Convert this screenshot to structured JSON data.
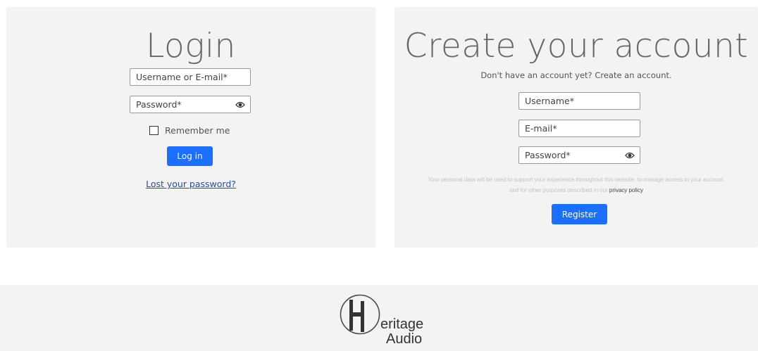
{
  "login": {
    "title": "Login",
    "username_placeholder": "Username or E-mail*",
    "password_placeholder": "Password*",
    "remember_label": "Remember me",
    "button_label": "Log in",
    "lost_password": "Lost your password?"
  },
  "register": {
    "title": "Create your account",
    "subtitle": "Don't have an account yet? Create an account.",
    "username_placeholder": "Username*",
    "email_placeholder": "E-mail*",
    "password_placeholder": "Password*",
    "privacy_text": "Your personal data will be used to support your experience throughout this website, to manage access to your account, and for other purposes described in our",
    "privacy_link": "privacy policy",
    "button_label": "Register"
  },
  "footer": {
    "logo_line1": "eritage",
    "logo_line2": "Audio"
  },
  "icons": {
    "eye": "eye-icon",
    "checkbox": "checkbox-icon",
    "logo": "heritage-audio-logo"
  },
  "colors": {
    "accent": "#1a6fff",
    "panel_bg": "#f3f3f3",
    "link": "#1f4fa8"
  }
}
